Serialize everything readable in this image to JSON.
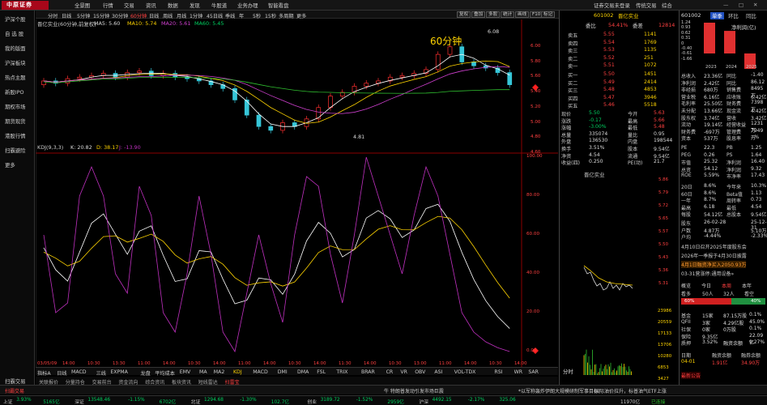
{
  "topbar": {
    "logo": "中原证券",
    "menu": [
      "全景图",
      "行情",
      "交易",
      "资讯",
      "数据",
      "发现",
      "牛股道",
      "业务办理",
      "智能看盘"
    ],
    "right": [
      "证券交易未登录",
      "传统交易",
      "综合"
    ]
  },
  "sidebar": {
    "items": [
      "沪深个股",
      "自 选 股",
      "我的版面",
      "沪深板块",
      "热点主题",
      "新股IPO",
      "期权市场",
      "期货现货",
      "港股行情",
      "扫霸避险",
      "更多"
    ],
    "footer": "扫霸交易"
  },
  "periods": {
    "items": [
      "分时",
      "日线",
      "5分钟",
      "15分钟",
      "30分钟",
      "60分钟",
      "日线",
      "周线",
      "月线",
      "1分钟",
      "45日线",
      "季线",
      "年",
      "5秒",
      "15秒",
      "多周期",
      "更多"
    ],
    "active": "60分钟",
    "right": [
      "复权",
      "叠加",
      "多股",
      "统计",
      "画线",
      "F10",
      "标记",
      "↑↓"
    ]
  },
  "legend_main": {
    "name": "晋亿实业(60分钟,前复权)",
    "ma5": "MA5: 5.60",
    "ma10": "MA10: 5.74",
    "ma20": "MA20: 5.61",
    "ma60": "MA60: 5.45",
    "overlay": "60分钟",
    "high_label": "6.08",
    "low_label": "4.81"
  },
  "price_axis": [
    "6.00",
    "5.80",
    "5.60",
    "5.40",
    "5.20",
    "5.00",
    "4.80",
    "4.60"
  ],
  "kdj": {
    "name": "KDJ(9,3,3)",
    "k": "K: 20.82",
    "d": "D: 38.17",
    "j": "J: -13.90",
    "axis": [
      "100.00",
      "80.00",
      "60.00",
      "40.00",
      "20.00",
      "0.00"
    ]
  },
  "time_axis": [
    "03/05/09",
    "14:00",
    "10:30",
    "13:30",
    "11:00",
    "14:00",
    "10:30",
    "14:00",
    "11:00",
    "14:00",
    "10:30",
    "14:00",
    "11:30",
    "14:00",
    "10:30",
    "13:00",
    "11:00",
    "14:00",
    "10:30",
    "14:00"
  ],
  "indicators": [
    "指标A",
    "日线",
    "MACD",
    "三线",
    "EXPMA",
    "龙盘",
    "平均成本",
    "EMV",
    "MA",
    "MA2",
    "KDJ",
    "MACD",
    "DMI",
    "DMA",
    "FSL",
    "TRIX",
    "BRAR",
    "CR",
    "VR",
    "OBV",
    "ASI",
    "VOL-TDX",
    "RSI",
    "WR",
    "SAR",
    "CCI",
    "ROC",
    "MTM",
    "BOLL",
    "PSY",
    "MCST",
    "流程",
    "指标",
    "更多"
  ],
  "subtabs": [
    "关联报价",
    "分量持仓",
    "交易前台",
    "资金流向",
    "综合资讯",
    "板块资讯",
    "短线雷达",
    "扫雷宝"
  ],
  "stock": {
    "code": "601002",
    "name": "晋亿实业",
    "webi_label": "委比",
    "webi": "54.41%",
    "weicha_label": "委差",
    "weicha": "12814",
    "asks": [
      [
        "卖五",
        "5.55",
        "1141"
      ],
      [
        "卖四",
        "5.54",
        "1769"
      ],
      [
        "卖三",
        "5.53",
        "1135"
      ],
      [
        "卖二",
        "5.52",
        "251"
      ],
      [
        "卖一",
        "5.51",
        "1072"
      ]
    ],
    "bids": [
      [
        "买一",
        "5.50",
        "1451"
      ],
      [
        "买二",
        "5.49",
        "2414"
      ],
      [
        "买三",
        "5.48",
        "4853"
      ],
      [
        "买四",
        "5.47",
        "3946"
      ],
      [
        "买五",
        "5.46",
        "5518"
      ]
    ],
    "quote": [
      [
        "现价",
        "5.50",
        "今开",
        "5.63"
      ],
      [
        "涨跌",
        "-0.17",
        "最高",
        "5.66"
      ],
      [
        "涨幅",
        "-3.00%",
        "最低",
        "5.48"
      ],
      [
        "总量",
        "335074",
        "量比",
        "0.95"
      ],
      [
        "外盘",
        "136530",
        "内盘",
        "198544"
      ],
      [
        "换手",
        "3.51%",
        "股本",
        "9.54亿"
      ],
      [
        "净资",
        "4.54",
        "流通",
        "9.54亿"
      ],
      [
        "收益(四)",
        "0.250",
        "PE(动)",
        "21.7"
      ]
    ],
    "mini_name": "晋亿实业",
    "mini_axis": [
      "5.86",
      "5.79",
      "5.72",
      "5.65",
      "5.57",
      "5.50",
      "5.43",
      "5.36",
      "5.31"
    ],
    "mini_vol": [
      "23986",
      "20559",
      "17133",
      "13706",
      "10280",
      "6853",
      "3427"
    ],
    "mini_tab": "分时"
  },
  "fund": {
    "code": "601002",
    "tabs": [
      "单季",
      "环比",
      "同比"
    ],
    "chart_title": "净利润(亿)",
    "chart_data": {
      "type": "bar",
      "categories": [
        "2023",
        "2024",
        "2025"
      ],
      "values": [
        1.24,
        0.91,
        -1.4
      ],
      "ylim": [
        -1.66,
        1.24
      ],
      "y_ticks": [
        "1.24",
        "0.93",
        "0.62",
        "0.31",
        "0",
        "-0.40",
        "-0.61",
        "-1.66"
      ]
    },
    "rows": [
      [
        "总收入",
        "23.36亿",
        "同比",
        "-1.40"
      ],
      [
        "净利润",
        "2.42亿",
        "同比",
        "86.12"
      ],
      [
        "非经损",
        "680万",
        "销售费",
        "8495万"
      ],
      [
        "营业税",
        "6.16亿",
        "应收账",
        "6.42亿"
      ],
      [
        "毛利率",
        "25.50亿",
        "财务费",
        "7398万"
      ],
      [
        "未分配",
        "13.66亿",
        "现金流",
        "4.42亿"
      ],
      [
        "股东权",
        "3.74亿",
        "营收",
        "3.42亿"
      ],
      [
        "流动",
        "19.14亿",
        "经营收益",
        "1231万"
      ],
      [
        "财务费",
        "-697万",
        "管理费",
        "7949万"
      ],
      [
        "资本",
        "537万",
        "股息率",
        "--%"
      ],
      [
        "PE",
        "22.3",
        "PB",
        "1.25"
      ],
      [
        "PEG",
        "0.26",
        "PS",
        "1.64"
      ],
      [
        "市值",
        "25.32",
        "净利润",
        "16.40"
      ],
      [
        "总资",
        "54.12",
        "净利润",
        "9.32"
      ],
      [
        "ROE",
        "5.59%",
        "市净率",
        "17.43"
      ],
      [
        "20日",
        "8.6%",
        "今年来",
        "10.3%"
      ],
      [
        "60日",
        "8.6%",
        "Beta值",
        "1.13"
      ],
      [
        "一年",
        "8.7%",
        "周转率",
        "0.73"
      ],
      [
        "最高",
        "6.18",
        "最低",
        "4.54"
      ],
      [
        "每股",
        "54.12亿",
        "总股本",
        "9.54亿"
      ],
      [
        "股东",
        "26-02-28",
        "",
        "25-12-31"
      ],
      [
        "户数",
        "4.87万",
        "",
        "5.10万"
      ],
      [
        "户均",
        "-4.44%",
        "",
        "-2.33%"
      ]
    ],
    "news": [
      "4月10日召开2025年度股东会",
      "2026年一季报于4月30日披露",
      "4月1日融资净买入2050.93万",
      "03-31营涨停:通用设备»"
    ],
    "hot_tabs": [
      "概览",
      "今日",
      "本周",
      "本年"
    ],
    "hot_rows": [
      [
        "看多",
        "50人",
        "32人",
        "看空"
      ]
    ],
    "hot_pct": [
      "60%",
      "40%"
    ],
    "capital": [
      [
        "基金",
        "15家",
        "87.15万股",
        "0.1%"
      ],
      [
        "QFII",
        "3家",
        "4.29亿股",
        "45.0%"
      ],
      [
        "社保",
        "0家",
        "0万股",
        "0.1%"
      ],
      [
        "保险",
        "9.35亿",
        "",
        "22.09亿"
      ],
      [
        "质押",
        "3.52%",
        "融资余额",
        "9.27%"
      ]
    ],
    "margin_rows": [
      [
        "日期",
        "融资余额",
        "融券余额"
      ],
      [
        "04-01",
        "1.91亿",
        "34.90万"
      ]
    ],
    "hint": "最新公告"
  },
  "bottom": {
    "alert": "牛 特朗普发动引发市场巨震",
    "news": "*以军称轰炸伊朗大规模研制军事目标",
    "news2": "国际油价拉升，标普油气ETF上涨",
    "tab": "已连接",
    "indices": [
      [
        "上证",
        "3.93%",
        "5165亿"
      ],
      [
        "深证",
        "13548.46",
        "-1.15%",
        "6702亿"
      ],
      [
        "北证",
        "1294.68",
        "-1.30%",
        "102.7亿"
      ],
      [
        "创业",
        "3189.72",
        "-1.52%",
        "2959亿"
      ],
      [
        "沪深",
        "4492.15",
        "-2.17%",
        "325.06"
      ]
    ],
    "time": "11970亿"
  }
}
